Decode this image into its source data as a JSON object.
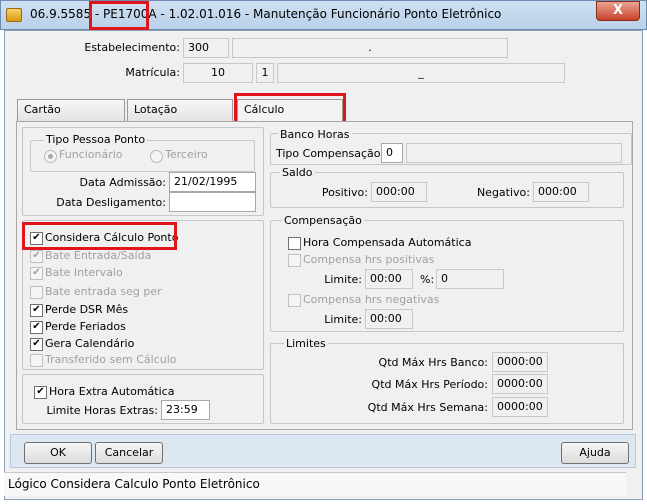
{
  "window": {
    "title_prefix": "06.9.5585 - ",
    "title_code": "PE1700A",
    "title_suffix": " - 1.02.01.016 - Manutenção Funcionário Ponto Eletrônico",
    "close_label": "X"
  },
  "header": {
    "estabelecimento_label": "Estabelecimento:",
    "estabelecimento_code": "300",
    "estabelecimento_name": ".",
    "matricula_label": "Matrícula:",
    "matricula_value": "10",
    "matricula_digit": "1",
    "matricula_name": "_"
  },
  "tabs": [
    {
      "label": "Cartão"
    },
    {
      "label": "Lotação"
    },
    {
      "label": "Cálculo"
    }
  ],
  "left": {
    "tipo_pessoa_title": "Tipo Pessoa Ponto",
    "radio_funcionario": "Funcionário",
    "radio_terceiro": "Terceiro",
    "data_admissao_label": "Data Admissão:",
    "data_admissao_value": "21/02/1995",
    "data_desligamento_label": "Data Desligamento:",
    "data_desligamento_value": "",
    "checks": [
      {
        "label": "Considera Cálculo Ponto",
        "checked": true,
        "disabled": false
      },
      {
        "label": "Bate Entrada/Saída",
        "checked": true,
        "disabled": true
      },
      {
        "label": "Bate Intervalo",
        "checked": true,
        "disabled": true
      },
      {
        "label": "Bate entrada seg per",
        "checked": false,
        "disabled": true
      },
      {
        "label": "Perde DSR Mês",
        "checked": true,
        "disabled": false
      },
      {
        "label": "Perde Feriados",
        "checked": true,
        "disabled": false
      },
      {
        "label": "Gera Calendário",
        "checked": true,
        "disabled": false
      },
      {
        "label": "Transferido sem Cálculo",
        "checked": false,
        "disabled": true
      }
    ],
    "hora_extra_label": "Hora Extra Automática",
    "limite_horas_label": "Limite Horas Extras:",
    "limite_horas_value": "23:59"
  },
  "right": {
    "banco_horas_title": "Banco Horas",
    "tipo_compensacao_label": "Tipo Compensação:",
    "tipo_compensacao_value": "0",
    "tipo_compensacao_desc": "",
    "saldo_title": "Saldo",
    "positivo_label": "Positivo:",
    "positivo_value": "000:00",
    "negativo_label": "Negativo:",
    "negativo_value": "000:00",
    "compensacao_title": "Compensação",
    "hora_compensada_label": "Hora Compensada Automática",
    "compensa_positivas_label": "Compensa hrs positivas",
    "limite_label": "Limite:",
    "limite_pos_value": "00:00",
    "percent_label": "%:",
    "percent_value": "0",
    "compensa_negativas_label": "Compensa hrs negativas",
    "limite_neg_value": "00:00",
    "limites_title": "Limites",
    "qtd_banco_label": "Qtd Máx Hrs Banco:",
    "qtd_banco_value": "0000:00",
    "qtd_periodo_label": "Qtd Máx Hrs Período:",
    "qtd_periodo_value": "0000:00",
    "qtd_semana_label": "Qtd Máx Hrs Semana:",
    "qtd_semana_value": "0000:00"
  },
  "buttons": {
    "ok": "OK",
    "cancelar": "Cancelar",
    "ajuda": "Ajuda"
  },
  "status_text": "Lógico Considera Calculo Ponto Eletrônico",
  "colors": {
    "highlight": "#e0161d",
    "titlebar": "#c4d8ee"
  }
}
